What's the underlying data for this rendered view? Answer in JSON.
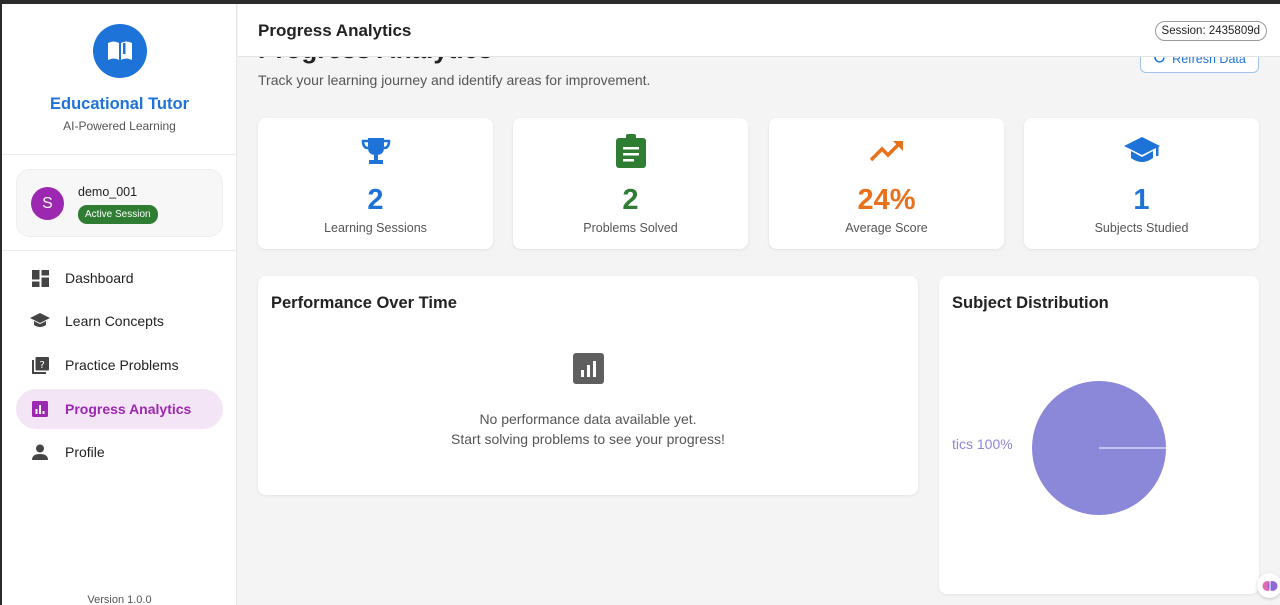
{
  "sidebar": {
    "app_title": "Educational Tutor",
    "app_subtitle": "AI-Powered Learning",
    "user": {
      "avatar_letter": "S",
      "name": "demo_001",
      "badge": "Active Session"
    },
    "nav": [
      {
        "label": "Dashboard",
        "icon": "dashboard-icon"
      },
      {
        "label": "Learn Concepts",
        "icon": "graduation-cap-icon"
      },
      {
        "label": "Practice Problems",
        "icon": "quiz-icon"
      },
      {
        "label": "Progress Analytics",
        "icon": "analytics-icon",
        "active": true
      },
      {
        "label": "Profile",
        "icon": "person-icon"
      }
    ],
    "version": "Version 1.0.0"
  },
  "header": {
    "title": "Progress Analytics",
    "session": "Session: 2435809d"
  },
  "main": {
    "heading": "Progress Analytics",
    "subtitle": "Track your learning journey and identify areas for improvement.",
    "refresh_label": "Refresh Data",
    "stats": [
      {
        "value": "2",
        "label": "Learning Sessions",
        "icon": "trophy-icon",
        "color": "#1e73d8"
      },
      {
        "value": "2",
        "label": "Problems Solved",
        "icon": "assignment-icon",
        "color": "#2e7d32"
      },
      {
        "value": "24%",
        "label": "Average Score",
        "icon": "trending-up-icon",
        "color": "#e8711c"
      },
      {
        "value": "1",
        "label": "Subjects Studied",
        "icon": "school-icon",
        "color": "#1e73d8"
      }
    ],
    "performance": {
      "title": "Performance Over Time",
      "empty_line1": "No performance data available yet.",
      "empty_line2": "Start solving problems to see your progress!"
    },
    "distribution": {
      "title": "Subject Distribution",
      "slice_label": "tics 100%"
    }
  },
  "chart_data": {
    "type": "pie",
    "slices": [
      {
        "value": 100,
        "color": "#8b87d9"
      }
    ]
  }
}
